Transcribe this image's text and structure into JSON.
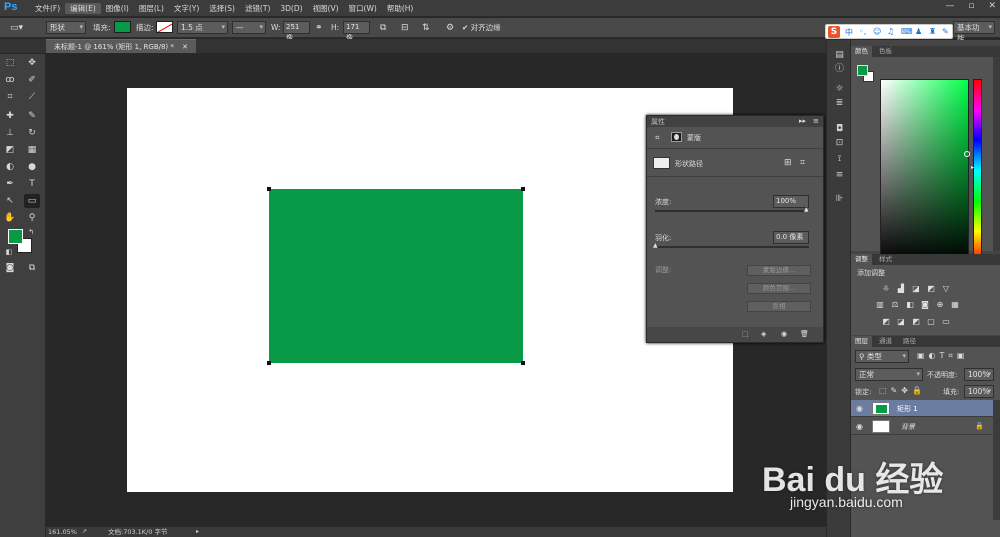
{
  "app": {
    "logo": "Ps"
  },
  "menu": [
    "文件(F)",
    "编辑(E)",
    "图像(I)",
    "图层(L)",
    "文字(Y)",
    "选择(S)",
    "滤镜(T)",
    "3D(D)",
    "视图(V)",
    "窗口(W)",
    "帮助(H)"
  ],
  "menu_active": "编辑(E)",
  "window_controls": {
    "minimize": "—",
    "restore": "▫",
    "close": "✕"
  },
  "options": {
    "mode": "形状",
    "fill_label": "填充:",
    "fill_color": "#079a47",
    "stroke_label": "描边:",
    "stroke_width": "1.5 点",
    "w_label": "W:",
    "w_value": "251 像",
    "h_label": "H:",
    "h_value": "171 像",
    "align_edges": "对齐边缘",
    "workspace": "基本功能"
  },
  "document": {
    "tab_title": "未标题-1 @ 161% (矩形 1, RGB/8) *",
    "shape_color": "#079a47"
  },
  "status": {
    "zoom": "161.05%",
    "doc_info": "文档:703.1K/0 字节"
  },
  "properties": {
    "title": "属性",
    "mask_label": "蒙版",
    "shape_path": "形状路径",
    "density_label": "浓度:",
    "density_value": "100%",
    "feather_label": "羽化:",
    "feather_value": "0.0 像素",
    "adjust_label": "调整:",
    "btn_mask_edge": "蒙版边缘...",
    "btn_color_range": "颜色范围...",
    "btn_invert": "反相"
  },
  "color_panel": {
    "tabs": [
      "颜色",
      "色板"
    ],
    "fg": "#079a47",
    "bg": "#ffffff"
  },
  "adjust_panel": {
    "tabs": [
      "调整",
      "样式"
    ],
    "add_label": "添加调整"
  },
  "layers_panel": {
    "tabs": [
      "图层",
      "通道",
      "路径"
    ],
    "filter": "类型",
    "blend_mode": "正常",
    "opacity_label": "不透明度:",
    "opacity_value": "100%",
    "lock_label": "锁定:",
    "fill_label": "填充:",
    "fill_value": "100%",
    "layers": [
      {
        "name": "矩形 1",
        "selected": true
      },
      {
        "name": "背景",
        "selected": false,
        "italic": true
      }
    ]
  },
  "watermark": {
    "brand": "Bai du 经验",
    "url": "jingyan.baidu.com"
  },
  "ime": {
    "label": "中"
  }
}
